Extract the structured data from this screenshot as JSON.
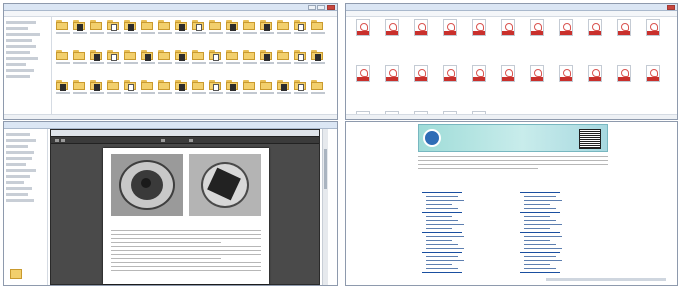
{
  "left_top_explorer": {
    "title": "",
    "menu": [
      "",
      "",
      "",
      "",
      ""
    ],
    "address": "",
    "nav_items": [
      "",
      "",
      "",
      "",
      "",
      "",
      "",
      "",
      "",
      ""
    ],
    "status": ""
  },
  "left_bottom_explorer": {
    "title": "",
    "nav_items": [
      "",
      "",
      "",
      "",
      "",
      "",
      "",
      "",
      "",
      "",
      "",
      ""
    ],
    "status": ""
  },
  "pdf_viewer": {
    "title": "",
    "page_indicator": "",
    "zoom": "",
    "caption": ""
  },
  "right_explorer": {
    "title": "",
    "tabs": [
      "",
      "",
      "",
      ""
    ],
    "menu": [
      ""
    ],
    "file_labels": [
      "",
      "",
      "",
      "",
      "",
      "",
      "",
      "",
      "",
      "",
      "",
      "",
      "",
      "",
      "",
      "",
      "",
      "",
      "",
      "",
      "",
      "",
      "",
      "",
      "",
      "",
      ""
    ],
    "status": ""
  },
  "web_page": {
    "banner_title": "",
    "intro": "",
    "section_heading": "",
    "left_col_heading": "",
    "right_col_heading": "",
    "footer": ""
  },
  "colors": {
    "folder": "#f2cf6c",
    "pdf_band": "#c9302c",
    "viewer_bg": "#4a4a4a",
    "banner": "#9fdcd8",
    "link": "#1a4fa0"
  }
}
